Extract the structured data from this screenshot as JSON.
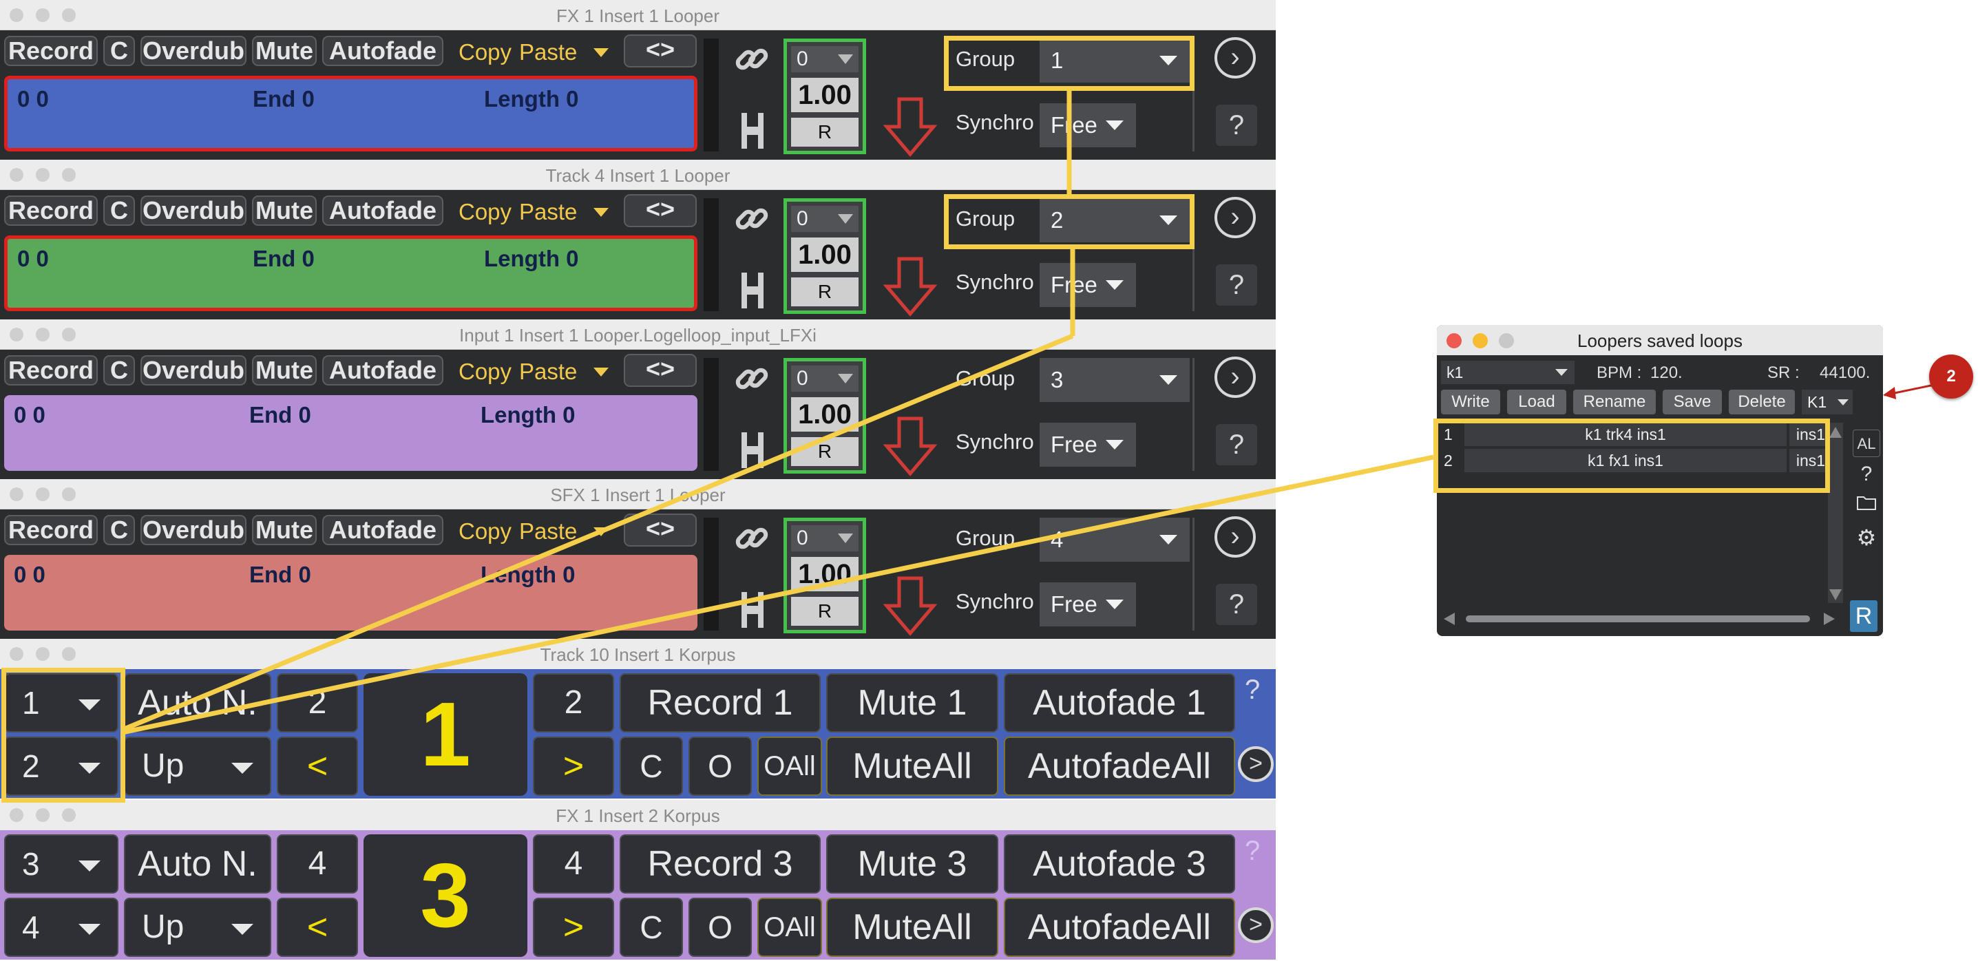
{
  "loopers": [
    {
      "title": "FX 1 Insert 1 Looper",
      "record": "Record",
      "c": "C",
      "overdub": "Overdub",
      "mute": "Mute",
      "autofade": "Autofade",
      "copy": "Copy",
      "paste": "Paste",
      "nav": "<>",
      "start": "0 0",
      "end": "End 0",
      "length": "Length 0",
      "num0": "0",
      "num1": "1.00",
      "num2": "R",
      "group_label": "Group",
      "group_value": "1",
      "synchro_label": "Synchro",
      "synchro_value": "Free",
      "help": "?",
      "wave_color": "#4a68c0"
    },
    {
      "title": "Track 4 Insert 1 Looper",
      "record": "Record",
      "c": "C",
      "overdub": "Overdub",
      "mute": "Mute",
      "autofade": "Autofade",
      "copy": "Copy",
      "paste": "Paste",
      "nav": "<>",
      "start": "0 0",
      "end": "End 0",
      "length": "Length 0",
      "num0": "0",
      "num1": "1.00",
      "num2": "R",
      "group_label": "Group",
      "group_value": "2",
      "synchro_label": "Synchro",
      "synchro_value": "Free",
      "help": "?",
      "wave_color": "#5aa85a"
    },
    {
      "title": "Input 1 Insert 1 Looper.Logelloop_input_LFXi",
      "record": "Record",
      "c": "C",
      "overdub": "Overdub",
      "mute": "Mute",
      "autofade": "Autofade",
      "copy": "Copy",
      "paste": "Paste",
      "nav": "<>",
      "start": "0 0",
      "end": "End 0",
      "length": "Length 0",
      "num0": "0",
      "num1": "1.00",
      "num2": "R",
      "group_label": "Group",
      "group_value": "3",
      "synchro_label": "Synchro",
      "synchro_value": "Free",
      "help": "?",
      "wave_color": "#b48fd6"
    },
    {
      "title": "SFX 1 Insert 1 Looper",
      "record": "Record",
      "c": "C",
      "overdub": "Overdub",
      "mute": "Mute",
      "autofade": "Autofade",
      "copy": "Copy",
      "paste": "Paste",
      "nav": "<>",
      "start": "0 0",
      "end": "End 0",
      "length": "Length 0",
      "num0": "0",
      "num1": "1.00",
      "num2": "R",
      "group_label": "Group",
      "group_value": "4",
      "synchro_label": "Synchro",
      "synchro_value": "Free",
      "help": "?",
      "wave_color": "#d27b76"
    }
  ],
  "korpus": [
    {
      "title": "Track 10 Insert 1 Korpus",
      "bg": "#4662b8",
      "group_a": "1",
      "group_b": "2",
      "auto_n": "Auto N.",
      "up": "Up",
      "num_top": "2",
      "prev": "<",
      "big": "1",
      "num_top2": "2",
      "next": ">",
      "record": "Record 1",
      "mute": "Mute 1",
      "autofade": "Autofade 1",
      "help": "?",
      "c": "C",
      "o": "O",
      "oall": "OAll",
      "muteall": "MuteAll",
      "autofadeall": "AutofadeAll",
      "go": ">"
    },
    {
      "title": "FX 1 Insert 2 Korpus",
      "bg": "#b68fd8",
      "group_a": "3",
      "group_b": "4",
      "auto_n": "Auto N.",
      "up": "Up",
      "num_top": "4",
      "prev": "<",
      "big": "3",
      "num_top2": "4",
      "next": ">",
      "record": "Record 3",
      "mute": "Mute 3",
      "autofade": "Autofade 3",
      "help": "?",
      "c": "C",
      "o": "O",
      "oall": "OAll",
      "muteall": "MuteAll",
      "autofadeall": "AutofadeAll",
      "go": ">"
    }
  ],
  "loops_window": {
    "title": "Loopers saved loops",
    "preset": "k1",
    "bpm_label": "BPM :",
    "bpm_value": "120.",
    "sr_label": "SR :",
    "sr_value": "44100.",
    "buttons": [
      "Write",
      "Load",
      "Rename",
      "Save",
      "Delete"
    ],
    "k_select": "K1",
    "rows": [
      {
        "index": "1",
        "name": "k1 trk4 ins1",
        "track": "trk4",
        "insert": "ins1"
      },
      {
        "index": "2",
        "name": "k1 fx1 ins1",
        "track": "fx1",
        "insert": "ins1"
      }
    ],
    "side": {
      "al": "AL",
      "help": "?",
      "r": "R"
    }
  },
  "badge": "2",
  "colors": {
    "highlight": "#f6cf4a",
    "badge": "#c0241b",
    "selected_outline": "#e0201c",
    "numbox_outline": "#46c24a"
  }
}
